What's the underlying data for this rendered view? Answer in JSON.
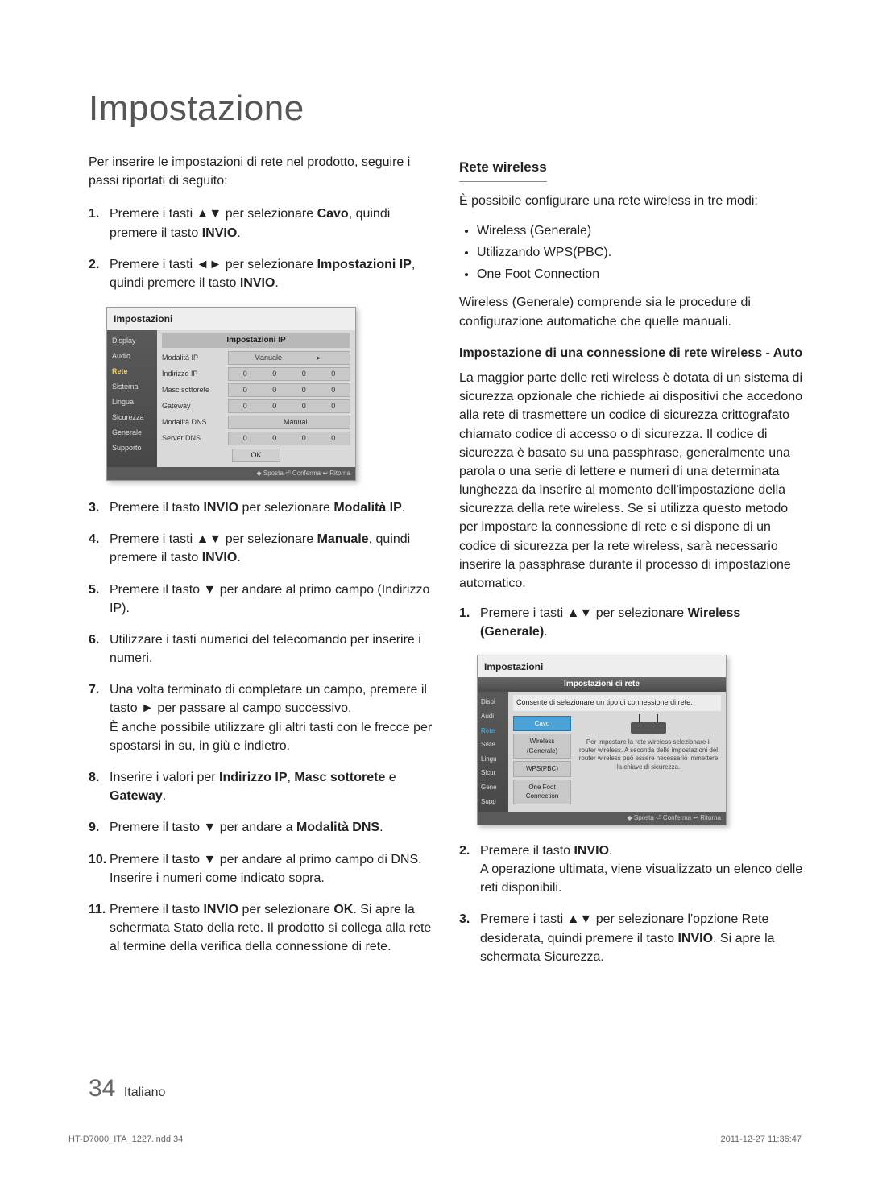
{
  "title": "Impostazione",
  "left": {
    "intro": "Per inserire le impostazioni di rete nel prodotto, seguire i passi riportati di seguito:",
    "step1_a": "Premere i tasti ",
    "step1_b": " per selezionare ",
    "step1_c": "Cavo",
    "step1_d": ", quindi premere il tasto ",
    "step1_e": "INVIO",
    "step1_f": ".",
    "step2_a": "Premere i tasti ",
    "step2_b": " per selezionare ",
    "step2_c": "Impostazioni IP",
    "step2_d": ", quindi premere il tasto ",
    "step2_e": "INVIO",
    "step2_f": ".",
    "step3_a": "Premere il tasto ",
    "step3_b": "INVIO",
    "step3_c": " per selezionare ",
    "step3_d": "Modalità IP",
    "step3_e": ".",
    "step4_a": "Premere i tasti ",
    "step4_b": " per selezionare ",
    "step4_c": "Manuale",
    "step4_d": ", quindi premere il tasto ",
    "step4_e": "INVIO",
    "step4_f": ".",
    "step5_a": "Premere il tasto ",
    "step5_b": " per andare al primo campo (Indirizzo IP).",
    "step6": "Utilizzare i tasti numerici del telecomando per inserire i numeri.",
    "step7_a": "Una volta terminato di completare un campo, premere il tasto ",
    "step7_b": " per passare al campo successivo.",
    "step7_c": "È anche possibile utilizzare gli altri tasti con le frecce per spostarsi in su, in giù e indietro.",
    "step8_a": "Inserire i valori per ",
    "step8_b": "Indirizzo IP",
    "step8_c": ", ",
    "step8_d": "Masc sottorete",
    "step8_e": " e ",
    "step8_f": "Gateway",
    "step8_g": ".",
    "step9_a": "Premere il tasto ",
    "step9_b": " per andare a ",
    "step9_c": "Modalità DNS",
    "step9_d": ".",
    "step10_a": "Premere il tasto ",
    "step10_b": " per andare al primo campo di DNS. Inserire i numeri come indicato sopra.",
    "step11_a": "Premere il tasto ",
    "step11_b": "INVIO",
    "step11_c": " per selezionare ",
    "step11_d": "OK",
    "step11_e": ". Si apre la schermata Stato della rete. Il prodotto si collega alla rete al termine della verifica della connessione di rete."
  },
  "shot1": {
    "title": "Impostazioni",
    "tab": "Impostazioni IP",
    "side": [
      "Display",
      "Audio",
      "Rete",
      "Sistema",
      "Lingua",
      "Sicurezza",
      "Generale",
      "Supporto"
    ],
    "side_sel_index": 2,
    "rows": {
      "r0": {
        "lbl": "Modalità IP",
        "val": "Manuale"
      },
      "r1": {
        "lbl": "Indirizzo IP"
      },
      "r2": {
        "lbl": "Masc sottorete"
      },
      "r3": {
        "lbl": "Gateway"
      },
      "r4": {
        "lbl": "Modalità DNS",
        "val": "Manual"
      },
      "r5": {
        "lbl": "Server DNS"
      }
    },
    "ok": "OK",
    "foot": "◆ Sposta   ⏎ Conferma   ↩ Ritorna"
  },
  "right": {
    "h3": "Rete wireless",
    "intro": "È possibile configurare una rete wireless in tre modi:",
    "bullets": [
      "Wireless (Generale)",
      "Utilizzando WPS(PBC).",
      "One Foot Connection"
    ],
    "note": "Wireless (Generale) comprende sia le procedure di configurazione automatiche che quelle manuali.",
    "h4": "Impostazione di una connessione di rete wireless - Auto",
    "para": "La maggior parte delle reti wireless è dotata di un sistema di sicurezza opzionale che richiede ai dispositivi che accedono alla rete di trasmettere un codice di sicurezza crittografato chiamato codice di accesso o di sicurezza. Il codice di sicurezza è basato su una passphrase, generalmente una parola o una serie di lettere e numeri di una determinata lunghezza da inserire al momento dell'impostazione della sicurezza della rete wireless. Se si utilizza questo metodo per impostare la connessione di rete e si dispone di un codice di sicurezza per la rete wireless, sarà necessario inserire la passphrase durante il processo di impostazione automatico.",
    "r1_a": "Premere i tasti ",
    "r1_b": " per selezionare ",
    "r1_c": "Wireless (Generale)",
    "r1_d": ".",
    "r2_a": "Premere il tasto ",
    "r2_b": "INVIO",
    "r2_c": ".",
    "r2_d": "A operazione ultimata, viene visualizzato un elenco delle reti disponibili.",
    "r3_a": "Premere i tasti ",
    "r3_b": " per selezionare l'opzione Rete desiderata, quindi premere il tasto ",
    "r3_c": "INVIO",
    "r3_d": ". Si apre la schermata Sicurezza."
  },
  "shot2": {
    "title": "Impostazioni",
    "bar": "Impostazioni di rete",
    "desc": "Consente di selezionare un tipo di connessione di rete.",
    "side": [
      "Displ",
      "Audi",
      "Rete",
      "Siste",
      "Lingu",
      "Sicur",
      "Gene",
      "Supp"
    ],
    "side_sel_index": 2,
    "opts": [
      "Cavo",
      "Wireless (Generale)",
      "WPS(PBC)",
      "One Foot Connection"
    ],
    "opt_sel_index": 0,
    "hint": "Per impostare la rete wireless selezionare il router wireless. A seconda delle impostazioni del router wireless può essere necessario immettere la chiave di sicurezza.",
    "foot": "◆ Sposta   ⏎ Conferma   ↩ Ritorna"
  },
  "arrows": {
    "ud": "▲▼",
    "lr": "◄►",
    "d": "▼",
    "r": "►"
  },
  "footer": {
    "num": "34",
    "lang": "Italiano"
  },
  "print": {
    "left": "HT-D7000_ITA_1227.indd   34",
    "right": "2011-12-27    11:36:47"
  }
}
